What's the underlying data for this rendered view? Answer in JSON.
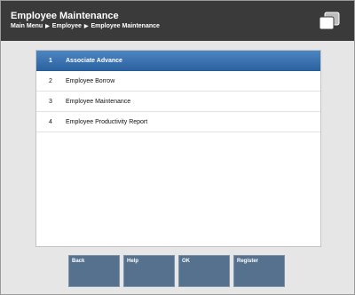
{
  "header": {
    "title": "Employee Maintenance",
    "breadcrumb": [
      "Main Menu",
      "Employee",
      "Employee Maintenance"
    ],
    "icon": "windows-icon"
  },
  "menu": {
    "items": [
      {
        "number": "1",
        "label": "Associate Advance",
        "selected": true
      },
      {
        "number": "2",
        "label": "Employee Borrow",
        "selected": false
      },
      {
        "number": "3",
        "label": "Employee Maintenance",
        "selected": false
      },
      {
        "number": "4",
        "label": "Employee Productivity Report",
        "selected": false
      }
    ]
  },
  "buttons": {
    "back": "Back",
    "help": "Help",
    "ok": "OK",
    "register": "Register"
  },
  "colors": {
    "header_bg": "#3a3a3a",
    "selected_row": "#3a75b5",
    "button_bg": "#55718e"
  }
}
